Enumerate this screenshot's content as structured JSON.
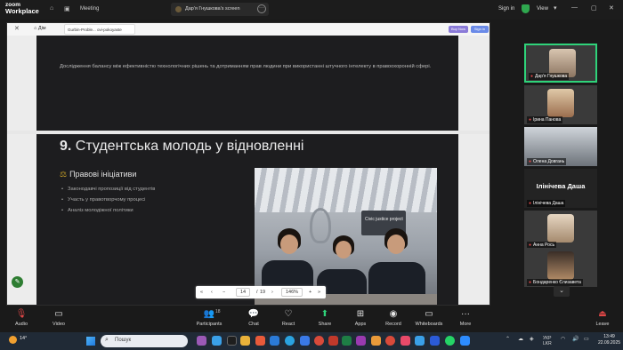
{
  "titlebar": {
    "app_name_1": "zoom",
    "app_name_2": "Workplace",
    "meeting_label": "Meeting",
    "shared_screen_title": "Дар'я Гнушкова's screen",
    "sign_in": "Sign in",
    "view": "View"
  },
  "viewer": {
    "home_label": "Дім",
    "doc_tab": "Gurbin-Proble... ovi-pokoyaste",
    "buy_now": "Buy Now",
    "sign_in": "Sign in"
  },
  "slide_prev": {
    "text": "Дослідження балансу між ефективністю технологічних рішень та дотриманням прав людини при використанні штучного інтелекту в правоохоронній сфері."
  },
  "slide": {
    "number": "9.",
    "title": "Студентська молодь у відновленні",
    "section_icon": "⚖",
    "section_title": "Правові ініціативи",
    "bullets": [
      "Законодавчі пропозиції від студентів",
      "Участь у правотворчому процесі",
      "Аналіз молодіжної політики"
    ],
    "image_sign": "Civic justice project"
  },
  "pager": {
    "current_page": "14",
    "total_pages": "19",
    "zoom": "146%"
  },
  "gallery": [
    {
      "name": "Дар'я Гнушкова",
      "active": true
    },
    {
      "name": "Ірина Панова"
    },
    {
      "name": "Олена Довгань"
    },
    {
      "big_name": "Ілінічева Даша",
      "name": "Ілінічева Даша"
    },
    {
      "name": "Анна Рось"
    },
    {
      "name": "Бондаренко Єлизавета"
    }
  ],
  "toolbar": {
    "audio": "Audio",
    "video": "Video",
    "participants": "Participants",
    "participants_count": "18",
    "chat": "Chat",
    "react": "React",
    "share": "Share",
    "record": "Record",
    "apps": "Apps",
    "whiteboards": "Whiteboards",
    "more": "More",
    "leave": "Leave"
  },
  "taskbar": {
    "weather": "14°",
    "search_placeholder": "Пошук",
    "lang_1": "УКР",
    "lang_2": "LKR",
    "time": "13:49",
    "date": "22.09.2025"
  },
  "colors": {
    "accent_green": "#2fd37a",
    "leave_red": "#e04747",
    "slide_bg": "#1d1d1f"
  }
}
